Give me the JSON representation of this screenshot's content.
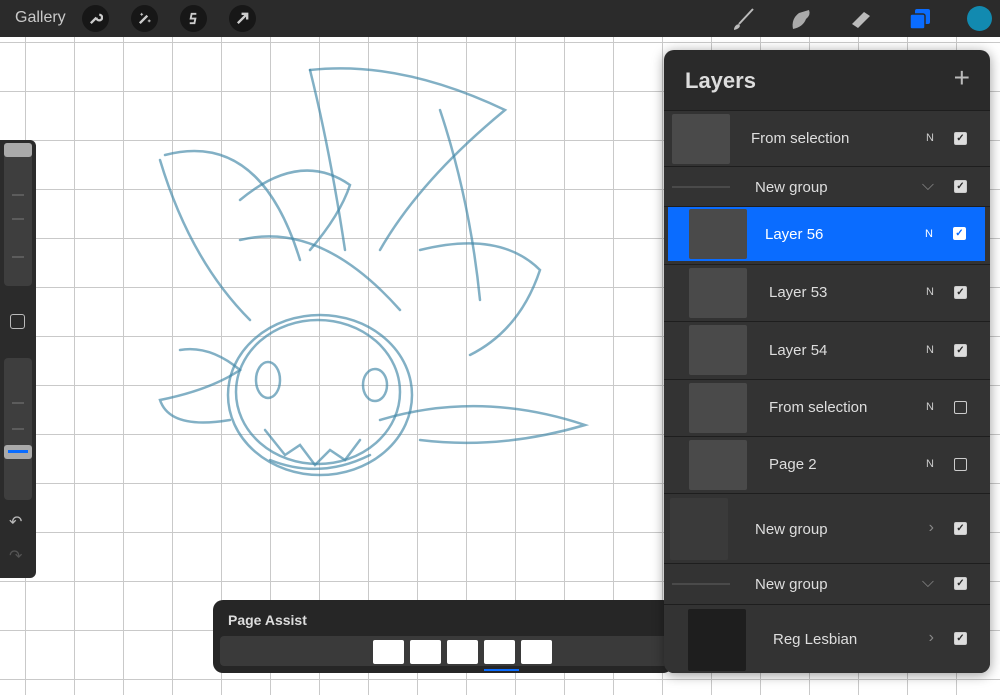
{
  "topbar": {
    "gallery": "Gallery",
    "tools_left": [
      "wrench-icon",
      "magic-wand-icon",
      "selection-icon",
      "transform-arrow-icon"
    ],
    "tools_right": [
      "brush-icon",
      "smudge-icon",
      "eraser-icon",
      "layers-icon"
    ],
    "color": "#128ab0",
    "accent": "#0a6cff"
  },
  "layers": {
    "title": "Layers",
    "add": "+",
    "items": [
      {
        "name": "From selection",
        "mode": "N",
        "visible": true
      },
      {
        "name": "New group",
        "visible": true,
        "expanded": true
      },
      {
        "name": "Layer 56",
        "mode": "N",
        "visible": true,
        "selected": true
      },
      {
        "name": "Layer 53",
        "mode": "N",
        "visible": true
      },
      {
        "name": "Layer 54",
        "mode": "N",
        "visible": true
      },
      {
        "name": "From selection",
        "mode": "N",
        "visible": false
      },
      {
        "name": "Page 2",
        "mode": "N",
        "visible": false
      },
      {
        "name": "New group",
        "visible": true,
        "expanded": false
      },
      {
        "name": "New group",
        "visible": true,
        "expanded": true
      },
      {
        "name": "Reg Lesbian",
        "visible": true,
        "expanded": false
      }
    ]
  },
  "page_assist": {
    "title": "Page Assist",
    "pages": 5,
    "current_page": 4
  }
}
